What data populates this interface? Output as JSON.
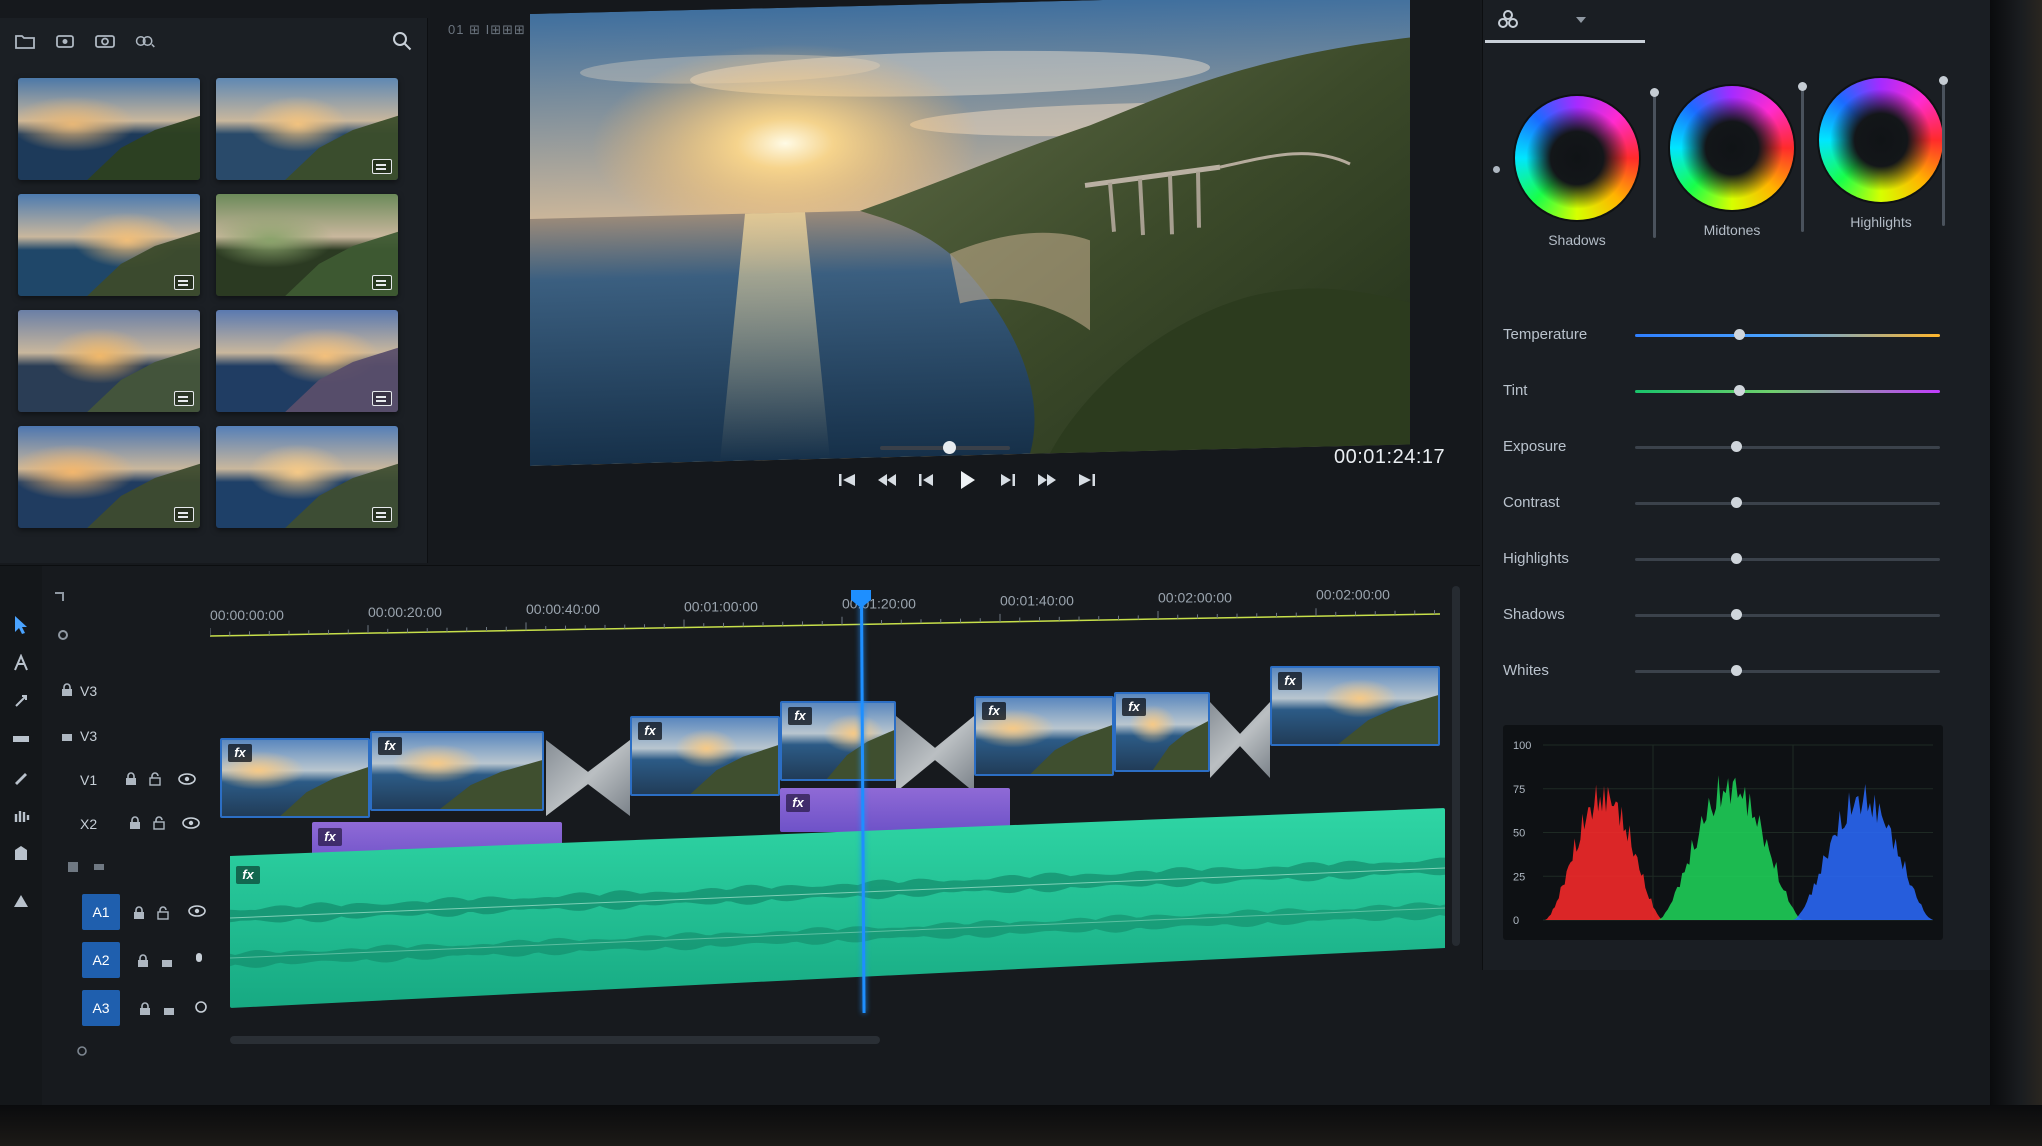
{
  "media_bin": {
    "thumbs": [
      {
        "badge": false
      },
      {
        "badge": true
      },
      {
        "badge": true
      },
      {
        "badge": true
      },
      {
        "badge": true
      },
      {
        "badge": true
      },
      {
        "badge": true
      },
      {
        "badge": true
      }
    ]
  },
  "viewer": {
    "tab_label": "01 ⊞ I⊞⊞⊞",
    "timecode": "00:01:24:17",
    "scrub_position": 0.53
  },
  "color_panel": {
    "wheels": [
      {
        "label": "Shadows"
      },
      {
        "label": "Midtones"
      },
      {
        "label": "Highlights"
      }
    ],
    "adjustments": [
      {
        "label": "Temperature",
        "value": 0.34,
        "track": "temperature"
      },
      {
        "label": "Tint",
        "value": 0.34,
        "track": "tint"
      },
      {
        "label": "Exposure",
        "value": 0.33,
        "track": "plain"
      },
      {
        "label": "Contrast",
        "value": 0.33,
        "track": "plain"
      },
      {
        "label": "Highlights",
        "value": 0.33,
        "track": "plain"
      },
      {
        "label": "Shadows",
        "value": 0.33,
        "track": "plain"
      },
      {
        "label": "Whites",
        "value": 0.33,
        "track": "plain"
      }
    ],
    "histogram": {
      "y_labels": [
        "100",
        "75",
        "50",
        "25",
        "0"
      ],
      "channel_colors": {
        "red": "#ff2a2a",
        "green": "#1fd85a",
        "blue": "#2a6bff"
      }
    }
  },
  "timeline": {
    "ruler": [
      "00:00:00:00",
      "00:00:20:00",
      "00:00:40:00",
      "00:01:00:00",
      "00:01:20:00",
      "00:01:40:00",
      "00:02:00:00",
      "00:02:00:00"
    ],
    "tracks": {
      "v3a": "V3",
      "v3b": "V3",
      "v1": "V1",
      "x2": "X2",
      "a1": "A1",
      "a2": "A2",
      "a3": "A3"
    },
    "fx_label": "fx"
  },
  "colors": {
    "accent": "#1e8fff",
    "panel_bg": "#1a1e23",
    "audio_clip": "#2fd6a5",
    "video_clip_border": "#2c6ec4",
    "overlay_clip": "#8f6ad6"
  }
}
